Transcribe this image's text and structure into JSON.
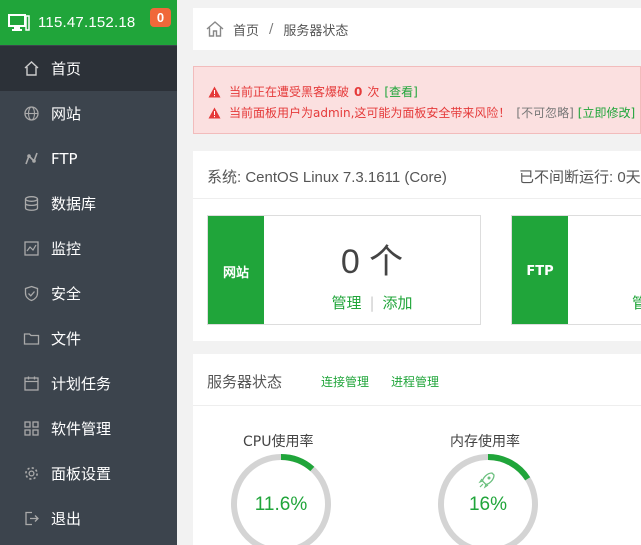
{
  "sidebar": {
    "ip": "115.47.152.18",
    "badge": "0",
    "items": [
      {
        "label": "首页",
        "icon": "home-icon",
        "active": true
      },
      {
        "label": "网站",
        "icon": "globe-icon"
      },
      {
        "label": "FTP",
        "icon": "ftp-icon"
      },
      {
        "label": "数据库",
        "icon": "database-icon"
      },
      {
        "label": "监控",
        "icon": "monitor-icon"
      },
      {
        "label": "安全",
        "icon": "shield-icon"
      },
      {
        "label": "文件",
        "icon": "folder-icon"
      },
      {
        "label": "计划任务",
        "icon": "calendar-icon"
      },
      {
        "label": "软件管理",
        "icon": "grid-icon"
      },
      {
        "label": "面板设置",
        "icon": "gear-icon"
      },
      {
        "label": "退出",
        "icon": "logout-icon"
      }
    ]
  },
  "breadcrumb": {
    "home": "首页",
    "separator": "/",
    "current": "服务器状态"
  },
  "alert": {
    "line1_prefix": "当前正在遭受黑客爆破",
    "line1_count": "0",
    "line1_suffix": "次",
    "line1_link": "[查看]",
    "line2_text": "当前面板用户为admin,这可能为面板安全带来风险！",
    "line2_ignore": "[不可忽略]",
    "line2_link": "[立即修改]"
  },
  "system": {
    "os": "系统: CentOS Linux 7.3.1611 (Core)",
    "uptime": "已不间断运行: 0天"
  },
  "cards": [
    {
      "tag": "网站",
      "count": "0 个",
      "manage": "管理",
      "sep": "|",
      "add": "添加"
    },
    {
      "tag": "FTP",
      "manage": "管"
    }
  ],
  "status": {
    "title": "服务器状态",
    "link_connections": "连接管理",
    "link_processes": "进程管理",
    "gauges": [
      {
        "label": "CPU使用率",
        "value": "11.6%",
        "percent": 11.6
      },
      {
        "label": "内存使用率",
        "value": "16%",
        "percent": 16,
        "icon": "rocket-icon"
      }
    ]
  },
  "colors": {
    "accent": "#20a53a",
    "sidebar": "#3c444d",
    "alert_text": "#e53a3a",
    "badge": "#f0683a"
  }
}
